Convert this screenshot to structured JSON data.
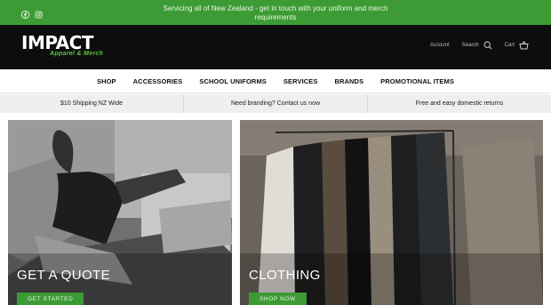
{
  "announcement": {
    "message": "Servicing all of New Zealand - get in touch with your uniform and merch requirements",
    "social": [
      "facebook-icon",
      "instagram-icon"
    ]
  },
  "header": {
    "logo_word": "IMPACT",
    "logo_sub": "Apparel & Merch",
    "account_label": "Account",
    "search_label": "Search",
    "cart_label": "Cart"
  },
  "nav": {
    "items": [
      "SHOP",
      "ACCESSORIES",
      "SCHOOL UNIFORMS",
      "SERVICES",
      "BRANDS",
      "PROMOTIONAL ITEMS"
    ]
  },
  "usp": [
    "$10 Shipping NZ Wide",
    "Need branding? Contact us now",
    "Free and easy domestic returns"
  ],
  "tiles": [
    {
      "title": "GET A QUOTE",
      "button": "GET STARTED"
    },
    {
      "title": "CLOTHING",
      "button": "SHOP NOW"
    }
  ],
  "colors": {
    "brand_green": "#3d9b35",
    "header_black": "#0d0d0d",
    "usp_bg": "#efefef"
  }
}
